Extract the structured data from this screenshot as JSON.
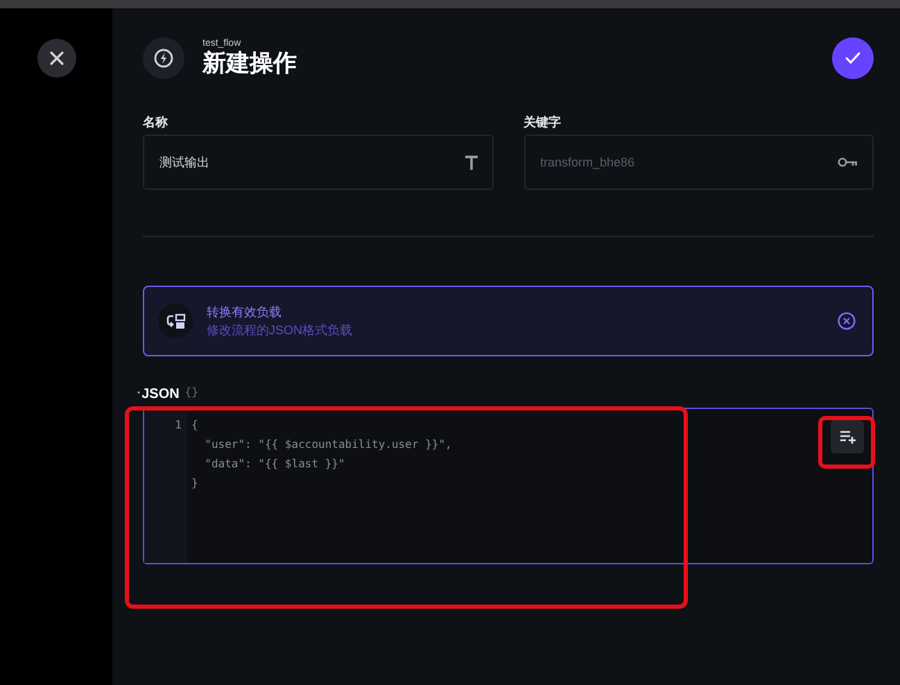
{
  "header": {
    "subtitle": "test_flow",
    "title": "新建操作"
  },
  "fields": [
    {
      "label": "名称",
      "value": "测试输出",
      "kind": "text"
    },
    {
      "label": "关键字",
      "placeholder": "transform_bhe86",
      "kind": "key"
    }
  ],
  "notice": {
    "title": "转换有效负载",
    "description": "修改流程的JSON格式负载"
  },
  "json_field": {
    "required_mark": "•",
    "label": "JSON",
    "type_hint": "{}",
    "line_numbers": [
      "1"
    ],
    "code_lines": [
      "{",
      "  \"user\": \"{{ $accountability.user }}\",",
      "  \"data\": \"{{ $last }}\"",
      "}"
    ]
  }
}
